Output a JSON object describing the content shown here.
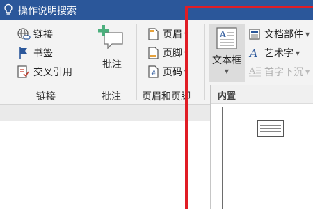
{
  "titlebar": {
    "tell_me": "操作说明搜索"
  },
  "links_group": {
    "hyperlink": "链接",
    "bookmark": "书签",
    "cross_reference": "交叉引用",
    "label": "链接"
  },
  "comments_group": {
    "comment": "批注",
    "label": "批注"
  },
  "header_footer_group": {
    "header": "页眉",
    "footer": "页脚",
    "page_number": "页码",
    "label": "页眉和页脚"
  },
  "text_group": {
    "text_box": "文本框",
    "quick_parts": "文档部件",
    "wordart": "艺术字",
    "drop_cap": "首字下沉"
  },
  "gallery": {
    "header": "内置"
  },
  "colors": {
    "accent": "#2b579a",
    "highlight": "#e01d25"
  },
  "icons": [
    "lightbulb-icon",
    "hyperlink-icon",
    "bookmark-icon",
    "cross-reference-icon",
    "new-comment-icon",
    "header-icon",
    "footer-icon",
    "page-number-icon",
    "text-box-icon",
    "quick-parts-icon",
    "wordart-icon",
    "drop-cap-icon"
  ]
}
